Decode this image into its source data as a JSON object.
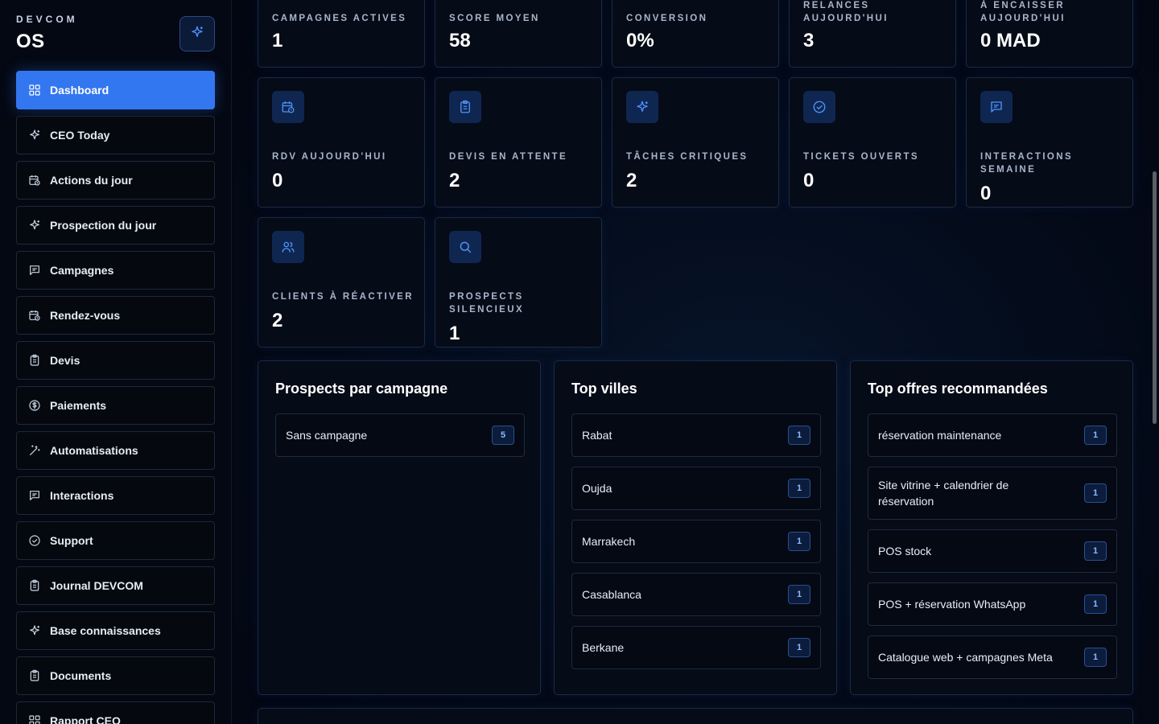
{
  "brand": {
    "top": "DEVCOM",
    "main": "OS"
  },
  "sidebar": {
    "items": [
      {
        "label": "Dashboard",
        "icon": "dashboard-grid-icon",
        "active": true
      },
      {
        "label": "CEO Today",
        "icon": "sparkles-icon"
      },
      {
        "label": "Actions du jour",
        "icon": "calendar-clock-icon"
      },
      {
        "label": "Prospection du jour",
        "icon": "sparkles-icon"
      },
      {
        "label": "Campagnes",
        "icon": "message-square-icon"
      },
      {
        "label": "Rendez-vous",
        "icon": "calendar-clock-icon"
      },
      {
        "label": "Devis",
        "icon": "clipboard-icon"
      },
      {
        "label": "Paiements",
        "icon": "dollar-circle-icon"
      },
      {
        "label": "Automatisations",
        "icon": "wand-icon"
      },
      {
        "label": "Interactions",
        "icon": "message-square-icon"
      },
      {
        "label": "Support",
        "icon": "check-circle-icon"
      },
      {
        "label": "Journal DEVCOM",
        "icon": "clipboard-icon"
      },
      {
        "label": "Base connaissances",
        "icon": "sparkles-icon"
      },
      {
        "label": "Documents",
        "icon": "clipboard-icon"
      },
      {
        "label": "Rapport CEO",
        "icon": "dashboard-grid-icon"
      }
    ]
  },
  "stats_top": [
    {
      "label": "CAMPAGNES ACTIVES",
      "value": "1"
    },
    {
      "label": "SCORE MOYEN",
      "value": "58"
    },
    {
      "label": "CONVERSION",
      "value": "0%"
    },
    {
      "label": "RELANCES AUJOURD'HUI",
      "value": "3"
    },
    {
      "label": "À ENCAISSER AUJOURD'HUI",
      "value": "0 MAD"
    }
  ],
  "stats_mid": [
    {
      "label": "RDV AUJOURD'HUI",
      "value": "0",
      "icon": "calendar-clock-icon"
    },
    {
      "label": "DEVIS EN ATTENTE",
      "value": "2",
      "icon": "clipboard-icon"
    },
    {
      "label": "TÂCHES CRITIQUES",
      "value": "2",
      "icon": "sparkles-icon"
    },
    {
      "label": "TICKETS OUVERTS",
      "value": "0",
      "icon": "check-circle-icon"
    },
    {
      "label": "INTERACTIONS SEMAINE",
      "value": "0",
      "icon": "message-square-icon"
    }
  ],
  "stats_low": [
    {
      "label": "CLIENTS À RÉACTIVER",
      "value": "2",
      "icon": "users-icon"
    },
    {
      "label": "PROSPECTS SILENCIEUX",
      "value": "1",
      "icon": "search-icon"
    }
  ],
  "panels": {
    "campaigns": {
      "title": "Prospects par campagne",
      "rows": [
        {
          "label": "Sans campagne",
          "count": "5"
        }
      ]
    },
    "cities": {
      "title": "Top villes",
      "rows": [
        {
          "label": "Rabat",
          "count": "1"
        },
        {
          "label": "Oujda",
          "count": "1"
        },
        {
          "label": "Marrakech",
          "count": "1"
        },
        {
          "label": "Casablanca",
          "count": "1"
        },
        {
          "label": "Berkane",
          "count": "1"
        }
      ]
    },
    "offers": {
      "title": "Top offres recommandées",
      "rows": [
        {
          "label": "réservation maintenance",
          "count": "1"
        },
        {
          "label": "Site vitrine + calendrier de réservation",
          "count": "1"
        },
        {
          "label": "POS stock",
          "count": "1"
        },
        {
          "label": "POS + réservation WhatsApp",
          "count": "1"
        },
        {
          "label": "Catalogue web + campagnes Meta",
          "count": "1"
        }
      ]
    }
  },
  "colors": {
    "accent": "#3377f0",
    "icon": "#4f93ff",
    "badge_text": "#8fb6ff"
  }
}
